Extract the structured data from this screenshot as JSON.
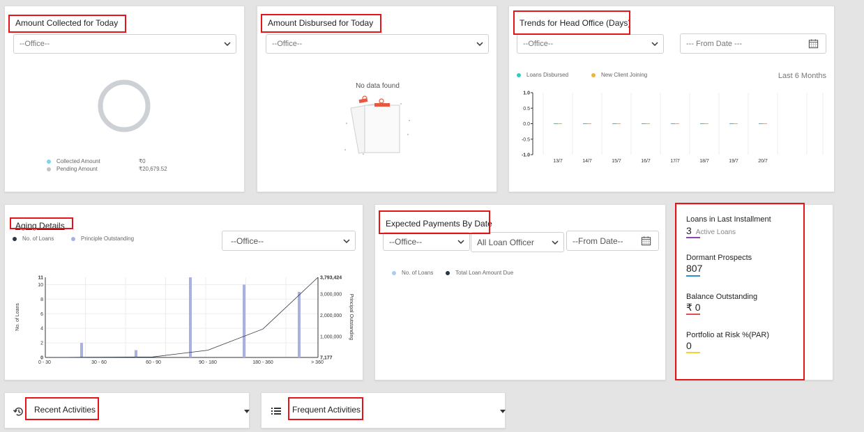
{
  "collected": {
    "title": "Amount Collected for Today",
    "office_value": "--Office--",
    "legend": [
      {
        "label": "Collected Amount",
        "value": "₹0",
        "color": "#7dd3ea"
      },
      {
        "label": "Pending Amount",
        "value": "₹20,679.52",
        "color": "#c0c4c8"
      }
    ]
  },
  "disbursed": {
    "title": "Amount Disbursed for Today",
    "office_value": "--Office--",
    "empty_text": "No data found"
  },
  "trends": {
    "title": "Trends for Head Office (Days)",
    "office_value": "--Office--",
    "from_date_placeholder": "--- From Date ---",
    "range_label": "Last 6 Months",
    "legend": [
      {
        "label": "Loans Disbursed",
        "color": "#35c9c4"
      },
      {
        "label": "New Client Joining",
        "color": "#f2b33d"
      }
    ]
  },
  "aging": {
    "title": "Aging Details",
    "office_value": "--Office--",
    "legend": [
      {
        "label": "No. of Loans",
        "color": "#2b3544"
      },
      {
        "label": "Principle Outstanding",
        "color": "#a9b1e0"
      }
    ]
  },
  "expected": {
    "title": "Expected Payments By Date",
    "office_value": "--Office--",
    "officer_value": "All Loan Officer",
    "from_date_placeholder": "--From Date--",
    "legend": [
      {
        "label": "No. of Loans",
        "color": "#a8cdf0"
      },
      {
        "label": "Total Loan Amount Due",
        "color": "#2b3544"
      }
    ]
  },
  "stats": {
    "items": [
      {
        "label": "Loans in Last Installment",
        "value": "3",
        "sub": "Active Loans",
        "color": "#8e44ad"
      },
      {
        "label": "Dormant Prospects",
        "value": "807",
        "sub": "",
        "color": "#2e8bd0"
      },
      {
        "label": "Balance Outstanding",
        "value": "₹ 0",
        "sub": "",
        "color": "#d9534f"
      },
      {
        "label": "Portfolio at Risk %(PAR)",
        "value": "0",
        "sub": "",
        "color": "#f1d52c"
      }
    ]
  },
  "activities": {
    "recent_label": "Recent Activities",
    "frequent_label": "Frequent Activities"
  },
  "chart_data": [
    {
      "type": "line",
      "categories": [
        "13/7",
        "14/7",
        "15/7",
        "16/7",
        "17/7",
        "18/7",
        "19/7",
        "20/7"
      ],
      "series": [
        {
          "name": "Loans Disbursed",
          "values": [
            0,
            0,
            0,
            0,
            0,
            0,
            0,
            0
          ]
        },
        {
          "name": "New Client Joining",
          "values": [
            0,
            0,
            0,
            0,
            0,
            0,
            0,
            0
          ]
        }
      ],
      "ylim": [
        -1.0,
        1.0
      ],
      "yticks": [
        "1.0",
        "0.5",
        "0.0",
        "-0.5",
        "-1.0"
      ],
      "grid": true
    },
    {
      "type": "bar",
      "categories": [
        "0 - 30",
        "30 - 60",
        "60 - 90",
        "90 - 180",
        "180 - 360",
        "> 360"
      ],
      "series": [
        {
          "name": "No. of Loans",
          "values": [
            0,
            2,
            1,
            11,
            10,
            9
          ]
        },
        {
          "name": "Principle Outstanding",
          "values": [
            7177,
            20000,
            30000,
            350000,
            1350000,
            3793424
          ]
        }
      ],
      "ylabel": "No. of Loans",
      "y2label": "Principal Outstanding",
      "ylim": [
        0,
        11
      ],
      "y2lim": [
        7177,
        3793424
      ],
      "yticks": [
        "11",
        "10",
        "8",
        "6",
        "4",
        "2",
        "0"
      ],
      "y2ticks": [
        "3,793,424",
        "3,000,000",
        "2,000,000",
        "1,000,000",
        "7,177"
      ],
      "grid": true
    }
  ]
}
